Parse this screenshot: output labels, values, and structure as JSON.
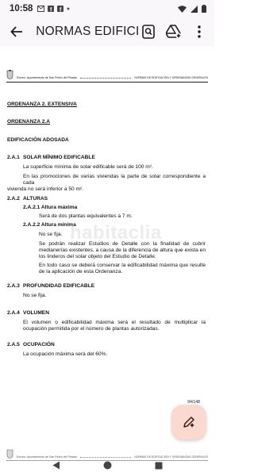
{
  "status_bar": {
    "time": "10:58",
    "left_icons": [
      "mail-icon",
      "facebook-icon",
      "facebook-icon",
      "dot-icon"
    ],
    "right_icons": [
      "wifi-icon",
      "signal-icon",
      "battery-icon"
    ]
  },
  "app_bar": {
    "title": "NORMAS EDIFICI...",
    "actions": [
      "search-icon",
      "drive-add-icon",
      "more-vert-icon"
    ]
  },
  "doc": {
    "header_left": "Excmo. Ayuntamiento de San Pedro del Pinatar",
    "header_right": "NORMAS DE EDIFICACIÓN Y ORDENANZAS GENERALES",
    "ordenanza_title": "ORDENANZA 2. EXTENSIVA",
    "ordenanza_sub": "ORDENANZA 2.A",
    "edificacion": "EDIFICACIÓN ADOSADA",
    "s1_num": "2.A.1",
    "s1_title": "SOLAR MÍNIMO EDIFICABLE",
    "s1_p1": "La superficie mínima de solar edificable será de 100 m².",
    "s1_p2_a": "En las promociones de varias viviendas la parte de solar correspondiente a cada",
    "s1_p2_b": "vivienda no será inferior a 50 m².",
    "s2_num": "2.A.2",
    "s2_title": "ALTURAS",
    "s2_1_title": "2.A.2.1 Altura máxima",
    "s2_1_p": "Será de dos plantas equivalentes a 7 m.",
    "s2_2_title": "2.A.2.2 Altura mínima",
    "s2_2_p1": "No se fija.",
    "s2_2_p2": "Se podrán realizar Estudios de Detalle con la finalidad de cubrir medianerías existentes, a causa de la diferencia de altura que exista en los linderos del solar objeto del Estudio de Detalle.",
    "s2_2_p3": "En todo caso se deberá conservar la edificabilidad máxima que resulte de la aplicación de esta Ordenanza.",
    "s3_num": "2.A.3",
    "s3_title": "PROFUNDIDAD EDIFICABLE",
    "s3_p": "No se fija.",
    "s4_num": "2.A.4",
    "s4_title": "VOLUMEN",
    "s4_p": "El volumen o edificabilidad máxima será el resultado de multiplicar la ocupación permitida por el número de plantas autorizadas.",
    "s5_num": "2.A.5",
    "s5_title": "OCUPACIÓN",
    "s5_p": "La ocupación máxima será del 60%.",
    "watermark": "habitaclia",
    "page_number": "94/148"
  },
  "fab": {
    "icon": "edit-sparkle-icon"
  },
  "nav": [
    "back-nav-icon",
    "home-nav-icon",
    "recents-nav-icon"
  ]
}
